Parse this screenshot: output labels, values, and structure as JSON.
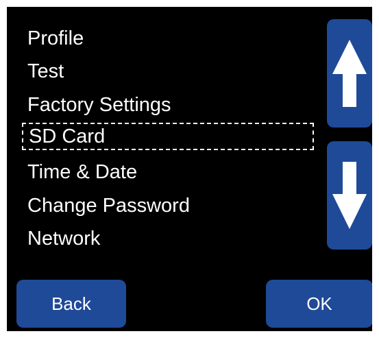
{
  "menu": {
    "items": [
      {
        "label": "Profile"
      },
      {
        "label": "Test"
      },
      {
        "label": "Factory Settings"
      },
      {
        "label": "SD Card",
        "selected": true
      },
      {
        "label": "Time & Date"
      },
      {
        "label": "Change Password"
      },
      {
        "label": "Network"
      }
    ]
  },
  "scroll": {
    "up_icon": "arrow-up-icon",
    "down_icon": "arrow-down-icon"
  },
  "footer": {
    "back_label": "Back",
    "ok_label": "OK"
  },
  "colors": {
    "screen_background": "#000000",
    "button_fill": "#1f4a98",
    "text": "#ffffff"
  }
}
